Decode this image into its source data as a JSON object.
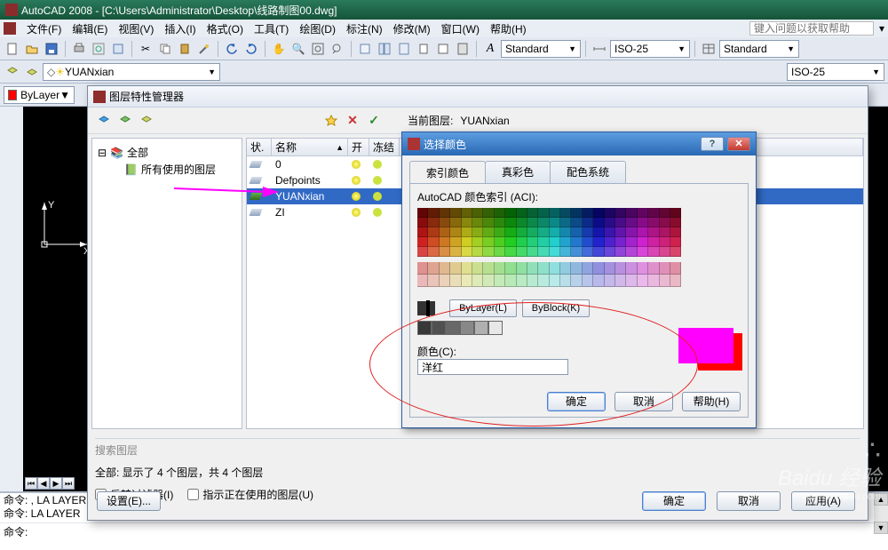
{
  "title_bar": "AutoCAD 2008 - [C:\\Users\\Administrator\\Desktop\\线路制图00.dwg]",
  "menu": {
    "items": [
      "文件(F)",
      "编辑(E)",
      "视图(V)",
      "插入(I)",
      "格式(O)",
      "工具(T)",
      "绘图(D)",
      "标注(N)",
      "修改(M)",
      "窗口(W)",
      "帮助(H)"
    ],
    "help_placeholder": "键入问题以获取帮助"
  },
  "style_combos": {
    "text_style": "Standard",
    "dim_style": "ISO-25",
    "table_style": "Standard",
    "dim_style2": "ISO-25",
    "yuanxian": "YUANxian"
  },
  "layer_bar": {
    "bylayer": "ByLayer"
  },
  "layer_dlg": {
    "title": "图层特性管理器",
    "current_layer_label": "当前图层:",
    "current_layer": "YUANxian",
    "tree": {
      "root": "全部",
      "child": "所有使用的图层"
    },
    "columns": {
      "status": "状.",
      "name": "名称",
      "on": "开",
      "freeze": "冻结"
    },
    "rows": [
      {
        "name": "0"
      },
      {
        "name": "Defpoints"
      },
      {
        "name": "YUANxian"
      },
      {
        "name": "ZI"
      }
    ],
    "search_label": "搜索图层",
    "status_line": "全部: 显示了 4 个图层，共 4 个图层",
    "invert_filter": "反转过滤器(I)",
    "indicate_in_use": "指示正在使用的图层(U)",
    "settings_btn": "设置(E)...",
    "ok": "确定",
    "cancel": "取消",
    "apply": "应用(A)"
  },
  "color_dlg": {
    "title": "选择颜色",
    "tabs": [
      "索引颜色",
      "真彩色",
      "配色系统"
    ],
    "aci_label": "AutoCAD 颜色索引 (ACI):",
    "bylayer_btn": "ByLayer(L)",
    "byblock_btn": "ByBlock(K)",
    "color_label": "颜色(C):",
    "color_value": "洋红",
    "ok": "确定",
    "cancel": "取消",
    "help": "帮助(H)",
    "std_colors": [
      "#ff0000",
      "#ffff00",
      "#00ff00",
      "#00ffff",
      "#0000ff",
      "#ff00ff",
      "#ffffff",
      "#808080",
      "#c0c0c0"
    ],
    "gray_colors": [
      "#383838",
      "#505050",
      "#686868",
      "#888888",
      "#b0b0b0",
      "#e8e8e8"
    ],
    "selected_index": 5
  },
  "cmd": {
    "line1": "命令:  , LA  LAYER",
    "line2": "命令:  LA  LAYER",
    "prompt": "命令:"
  },
  "chart_data": null
}
